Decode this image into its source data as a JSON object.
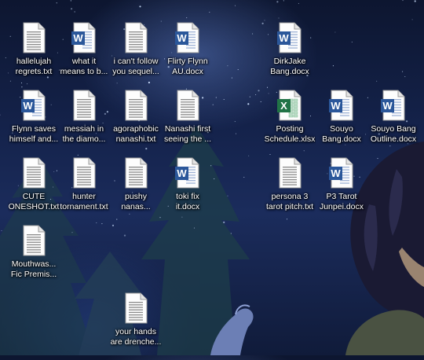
{
  "desktop": {
    "icons": [
      {
        "label": "hallelujah\nregrets.txt",
        "type": "txt"
      },
      {
        "label": "what it\nmeans to b...",
        "type": "docx"
      },
      {
        "label": "i can't follow\nyou sequel...",
        "type": "txt"
      },
      {
        "label": "Flirty Flynn\nAU.docx",
        "type": "docx"
      },
      {
        "label": "DirkJake\nBang.docx",
        "type": "docx"
      },
      {
        "label": "Flynn saves\nhimself and...",
        "type": "docx"
      },
      {
        "label": "messiah in\nthe diamo...",
        "type": "txt"
      },
      {
        "label": "agoraphobic\nnanashi.txt",
        "type": "txt"
      },
      {
        "label": "Nanashi first\nseeing the ...",
        "type": "txt"
      },
      {
        "label": "Posting\nSchedule.xlsx",
        "type": "xlsx"
      },
      {
        "label": "Souyo\nBang.docx",
        "type": "docx"
      },
      {
        "label": "Souyo Bang\nOutline.docx",
        "type": "docx"
      },
      {
        "label": "CUTE\nONESHOT.txt",
        "type": "txt"
      },
      {
        "label": "hunter\ntornament.txt",
        "type": "txt"
      },
      {
        "label": "pushy\nnanas...",
        "type": "txt"
      },
      {
        "label": "toki fix\nit.docx",
        "type": "docx"
      },
      {
        "label": "persona 3\ntarot pitch.txt",
        "type": "txt"
      },
      {
        "label": "P3 Tarot\nJunpei.docx",
        "type": "docx"
      },
      {
        "label": "Mouthwas...\nFic Premis...",
        "type": "txt"
      },
      {
        "label": "your hands\nare drenche...",
        "type": "txt"
      }
    ]
  },
  "colors": {
    "word_blue": "#2b579a",
    "excel_green": "#217346",
    "text_white": "#ffffff"
  }
}
